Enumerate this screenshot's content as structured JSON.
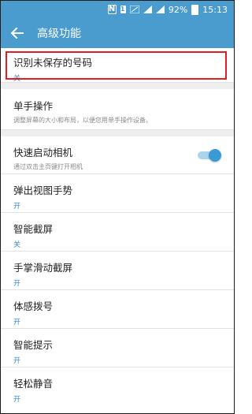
{
  "statusbar": {
    "nfc_label": "N",
    "sim_label": "1",
    "battery": "92%",
    "time": "15:13"
  },
  "appbar": {
    "title": "高级功能"
  },
  "items": [
    {
      "title": "识别未保存的号码",
      "sub": "关"
    },
    {
      "title": "单手操作",
      "sub": "调整屏幕的大小和布局，以便您用单手操作设备。"
    },
    {
      "title": "快速启动相机",
      "sub": "通过双击主页键打开相机"
    },
    {
      "title": "弹出视图手势",
      "sub": "开"
    },
    {
      "title": "智能截屏",
      "sub": "关"
    },
    {
      "title": "手掌滑动截屏",
      "sub": "开"
    },
    {
      "title": "体感拨号",
      "sub": "开"
    },
    {
      "title": "智能提示",
      "sub": "开"
    },
    {
      "title": "轻松静音",
      "sub": "开"
    }
  ],
  "colors": {
    "accent": "#4a9ccf",
    "highlight": "#e02020",
    "status_on": "#3a86c8"
  }
}
